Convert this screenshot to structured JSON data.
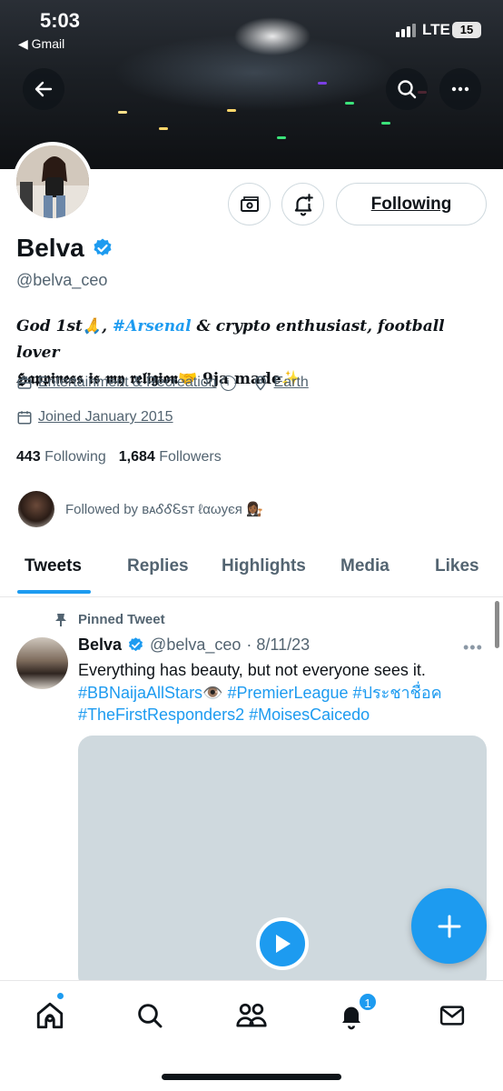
{
  "status_bar": {
    "time": "5:03",
    "back_app": "◀ Gmail",
    "network": "LTE",
    "battery": "15"
  },
  "profile": {
    "name": "Belva",
    "handle": "@belva_ceo",
    "bio_line1_prefix": "God 1st🙏, ",
    "bio_tag": "#Arsenal",
    "bio_line1_suffix": " & crypto enthusiast, football lover",
    "bio_line2": "𝕳𝖆𝖕𝖕𝖎𝖓𝖊𝖘𝖘 𝖎𝖘 𝖒𝖞 𝖗𝖊𝖑𝖎𝖌𝖎𝖔𝖓🤝 9ja made✨",
    "category": "Entertainment & Recreation",
    "location": "Earth",
    "joined": "Joined January 2015",
    "following_count": "443",
    "following_label": "Following",
    "followers_count": "1,684",
    "followers_label": "Followers",
    "followed_by": "Followed by ʙᴀᎴᎴᏋꜱᴛ ℓαωуєя 👩🏾‍⚖️",
    "following_button": "Following"
  },
  "tabs": [
    {
      "label": "Tweets",
      "active": true
    },
    {
      "label": "Replies",
      "active": false
    },
    {
      "label": "Highlights",
      "active": false
    },
    {
      "label": "Media",
      "active": false
    },
    {
      "label": "Likes",
      "active": false
    }
  ],
  "pinned_tweet": {
    "pinned_label": "Pinned Tweet",
    "author_name": "Belva",
    "author_handle": "@belva_ceo",
    "date": "· 8/11/23",
    "text": "Everything has beauty, but not everyone sees it.",
    "hashtags_line1": "#BBNaijaAllStars👁️ #PremierLeague #ประชาชื่อค",
    "hashtags_line2": "#TheFirstResponders2 #MoisesCaicedo"
  },
  "bottom_nav": {
    "notifications_badge": "1"
  },
  "icons": {
    "back": "back-arrow-icon",
    "search": "search-icon",
    "more": "more-icon",
    "tip": "tip-jar-icon",
    "bell_plus": "notification-subscribe-icon",
    "verified": "verified-badge-icon",
    "briefcase": "briefcase-icon",
    "location": "location-pin-icon",
    "calendar": "calendar-icon",
    "pin": "pin-icon",
    "play": "play-icon",
    "compose": "plus-icon",
    "home": "home-icon",
    "explore": "search-icon",
    "communities": "communities-icon",
    "notifications": "bell-icon",
    "messages": "mail-icon"
  },
  "colors": {
    "accent": "#1d9bf0",
    "text_primary": "#0f1419",
    "text_secondary": "#536471"
  }
}
